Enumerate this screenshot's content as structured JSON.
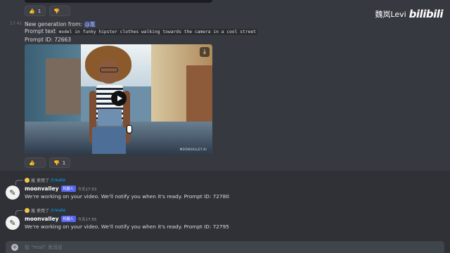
{
  "watermark": {
    "name": "魏岚Levi",
    "logo": "bilibili"
  },
  "reactions_top": [
    {
      "emoji": "👍",
      "count": "1"
    },
    {
      "emoji": "👎",
      "count": ""
    }
  ],
  "generation": {
    "timestamp": "17:41",
    "heading": "New generation from: ",
    "mention": "@嵐",
    "prompt_label": "Prompt text",
    "prompt_text": "model in funky hipster clothes walking towards the camera in a cool street",
    "prompt_id": "Prompt ID: 72663"
  },
  "video": {
    "watermark_text": "MOONVALLEY.AI"
  },
  "reactions_bottom": [
    {
      "emoji": "👍",
      "count": ""
    },
    {
      "emoji": "👎",
      "count": "1"
    }
  ],
  "messages": [
    {
      "reply_user": "嵐",
      "reply_action": "使用了",
      "reply_command": "/create",
      "author": "moonvalley",
      "bot_tag": "机器人",
      "time": "今天17:53",
      "text": "We're working on your video. We'll notify you when it's ready. Prompt ID: 72780"
    },
    {
      "reply_user": "嵐",
      "reply_action": "使用了",
      "reply_command": "/create",
      "author": "moonvalley",
      "bot_tag": "机器人",
      "time": "今天17:55",
      "text": "We're working on your video. We'll notify you when it's ready. Prompt ID: 72795"
    }
  ],
  "input": {
    "placeholder": "给 \"mail\" 发消息"
  }
}
